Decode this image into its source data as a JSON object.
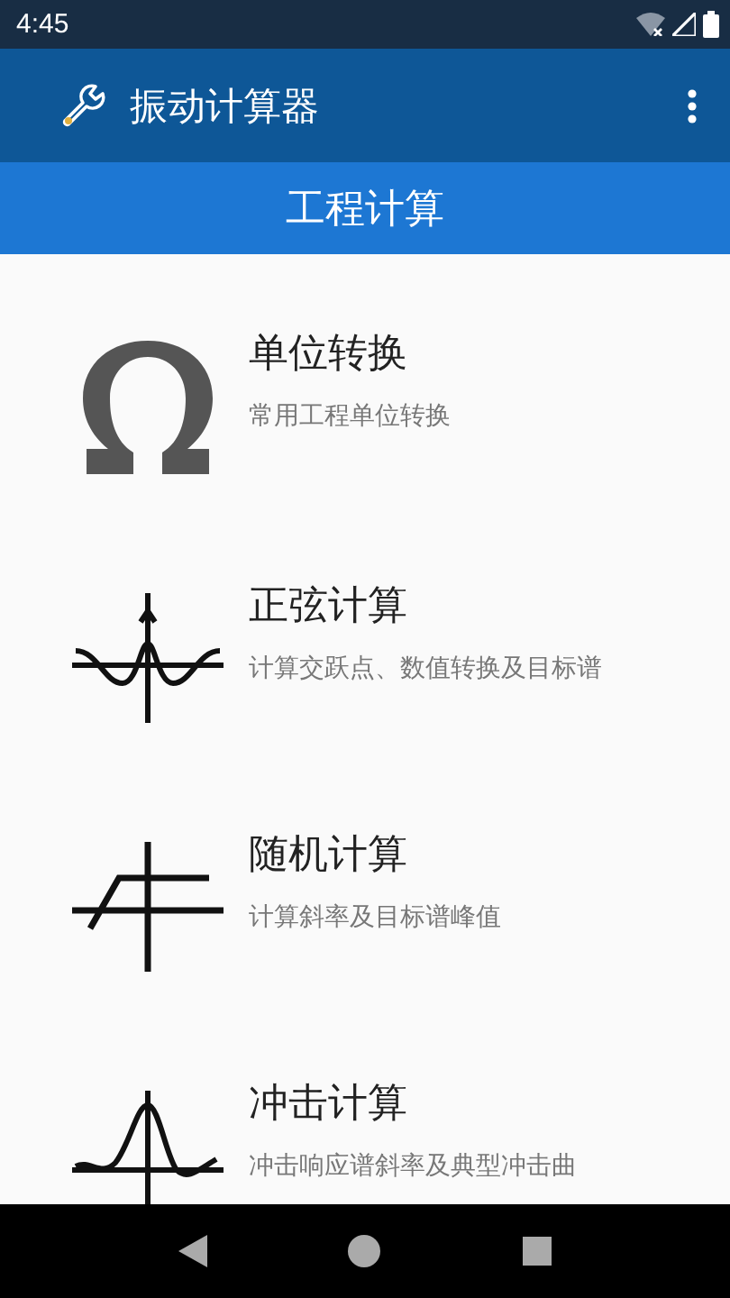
{
  "status_bar": {
    "time": "4:45"
  },
  "app_bar": {
    "title": "振动计算器"
  },
  "section": {
    "title": "工程计算"
  },
  "items": [
    {
      "title": "单位转换",
      "subtitle": "常用工程单位转换"
    },
    {
      "title": "正弦计算",
      "subtitle": "计算交跃点、数值转换及目标谱"
    },
    {
      "title": "随机计算",
      "subtitle": "计算斜率及目标谱峰值"
    },
    {
      "title": "冲击计算",
      "subtitle": "冲击响应谱斜率及典型冲击曲"
    }
  ]
}
